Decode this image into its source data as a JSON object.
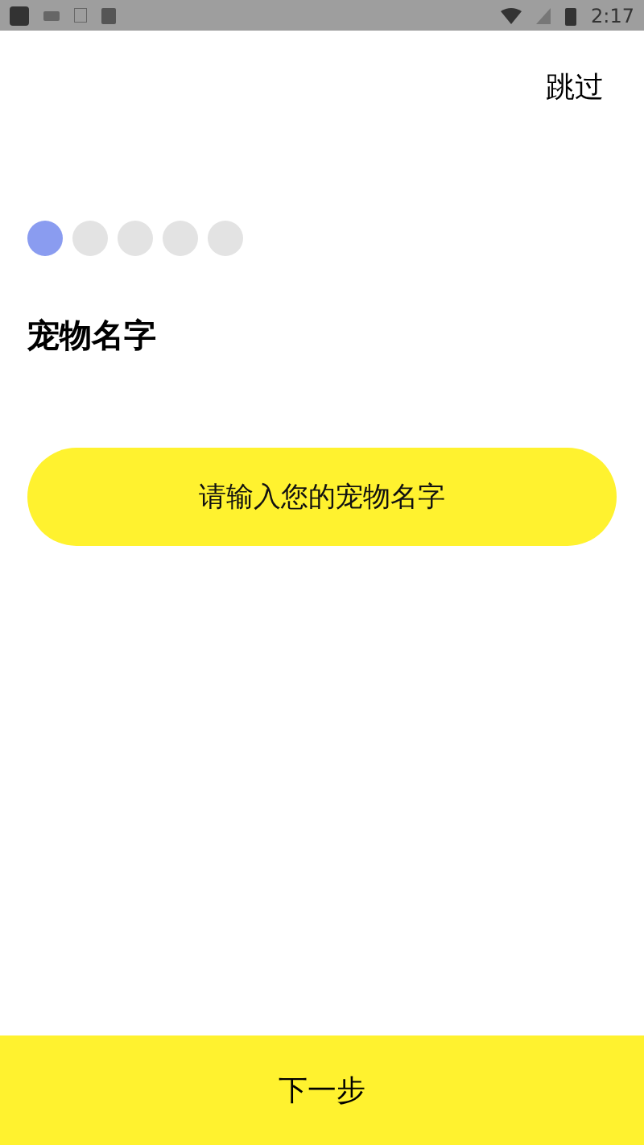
{
  "status_bar": {
    "time": "2:17"
  },
  "skip": "跳过",
  "steps": [
    {
      "selected": true
    },
    {
      "selected": false
    },
    {
      "selected": false
    },
    {
      "selected": false
    },
    {
      "selected": false
    }
  ],
  "title": "宠物名字",
  "name_field": {
    "placeholder": "请输入您的宠物名字"
  },
  "next_button": "下一步"
}
